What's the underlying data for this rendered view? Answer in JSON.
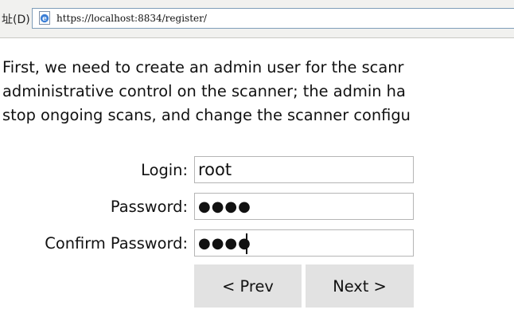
{
  "browser": {
    "address_label": "址(D)",
    "url": "https://localhost:8834/register/",
    "page_icon": "ie-page-icon"
  },
  "intro": {
    "lines": [
      "First, we need to create an admin user for the scanr",
      "administrative control on the scanner; the admin ha",
      "stop ongoing scans, and change the scanner configu"
    ]
  },
  "form": {
    "login": {
      "label": "Login:",
      "value": "root"
    },
    "password": {
      "label": "Password:",
      "value": "●●●●"
    },
    "confirm_password": {
      "label": "Confirm Password:",
      "value": "●●●●"
    }
  },
  "buttons": {
    "prev": "< Prev",
    "next": "Next >"
  },
  "colors": {
    "button_background": "#e2e2e2",
    "field_border": "#b5b5b5",
    "address_bar_border": "#7f9db9"
  }
}
